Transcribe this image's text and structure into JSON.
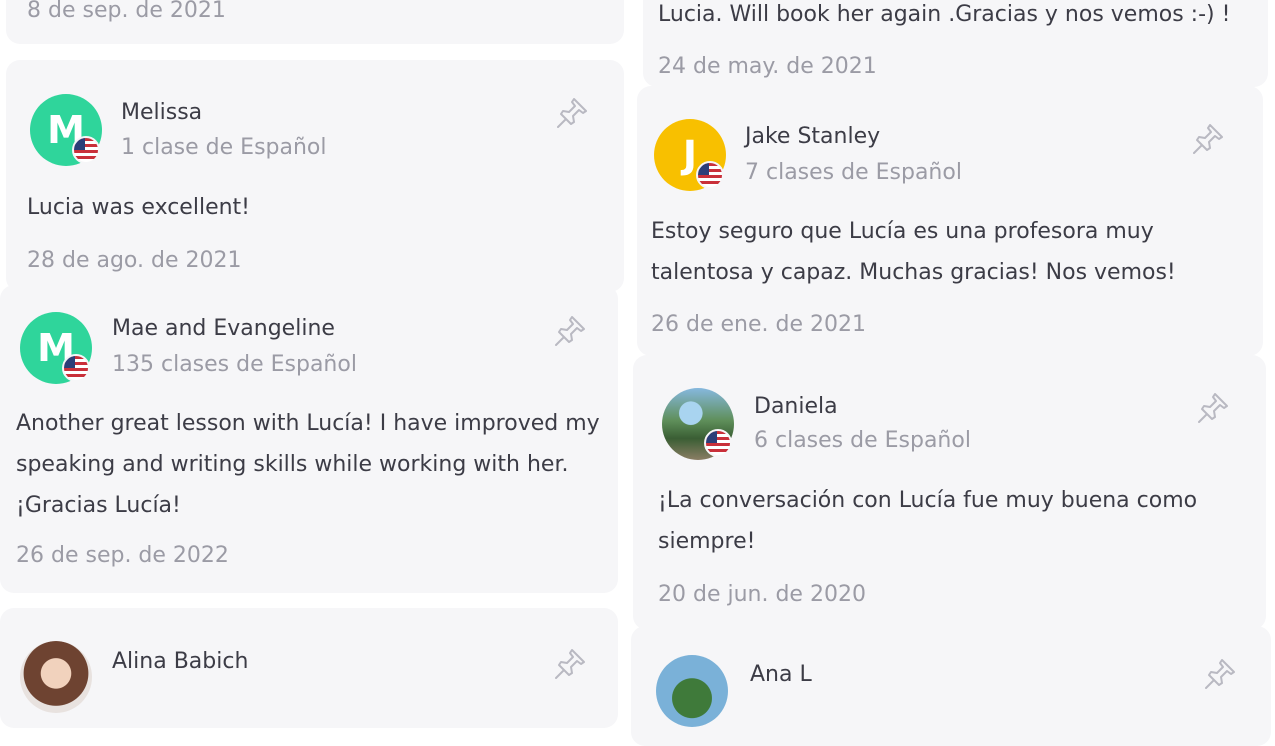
{
  "reviews": [
    {
      "date": "8 de sep. de 2021"
    },
    {
      "text": "Lucia. Will book her again .Gracias y nos vemos :-) !",
      "date": "24 de may. de 2021"
    },
    {
      "name": "Melissa",
      "initial": "M",
      "lessons": "1 clase de Español",
      "text": "Lucia was excellent!",
      "date": "28 de ago. de 2021"
    },
    {
      "name": "Jake Stanley",
      "initial": "J",
      "lessons": "7 clases de Español",
      "text": "Estoy seguro que Lucía es una profesora muy talentosa y capaz. Muchas gracias! Nos vemos!",
      "date": "26 de ene. de 2021"
    },
    {
      "name": "Mae and Evangeline",
      "initial": "M",
      "lessons": "135 clases de Español",
      "text": "Another great lesson with Lucía! I have improved my speaking and writing skills while working with her. ¡Gracias Lucía!",
      "date": "26 de sep. de 2022"
    },
    {
      "name": "Daniela",
      "lessons": "6 clases de Español",
      "text": "¡La conversación con Lucía fue muy buena como siempre!",
      "date": "20 de jun. de 2020"
    },
    {
      "name": "Alina Babich"
    },
    {
      "name": "Ana L"
    }
  ],
  "icons": {
    "pin": "pin-icon",
    "flag": "us-flag-icon"
  },
  "colors": {
    "card": "#f6f6f8",
    "green_avatar": "#2fd59b",
    "yellow_avatar": "#f8c000",
    "muted_text": "#9b9ba5"
  }
}
